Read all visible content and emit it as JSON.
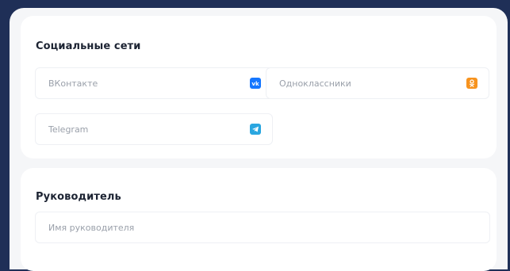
{
  "social": {
    "title": "Социальные сети",
    "vk": {
      "placeholder": "ВКонтакте",
      "value": "",
      "icon": "vk-icon",
      "color": "#1677ff"
    },
    "ok": {
      "placeholder": "Одноклассники",
      "value": "",
      "icon": "odnoklassniki-icon",
      "color": "#f7931e"
    },
    "telegram": {
      "placeholder": "Telegram",
      "value": "",
      "icon": "telegram-icon",
      "color": "#2aa6e0"
    }
  },
  "manager": {
    "title": "Руководитель",
    "name": {
      "placeholder": "Имя руководителя",
      "value": ""
    }
  },
  "colors": {
    "background": "#1f2f57",
    "panel": "#f5f6f8",
    "card": "#ffffff"
  }
}
